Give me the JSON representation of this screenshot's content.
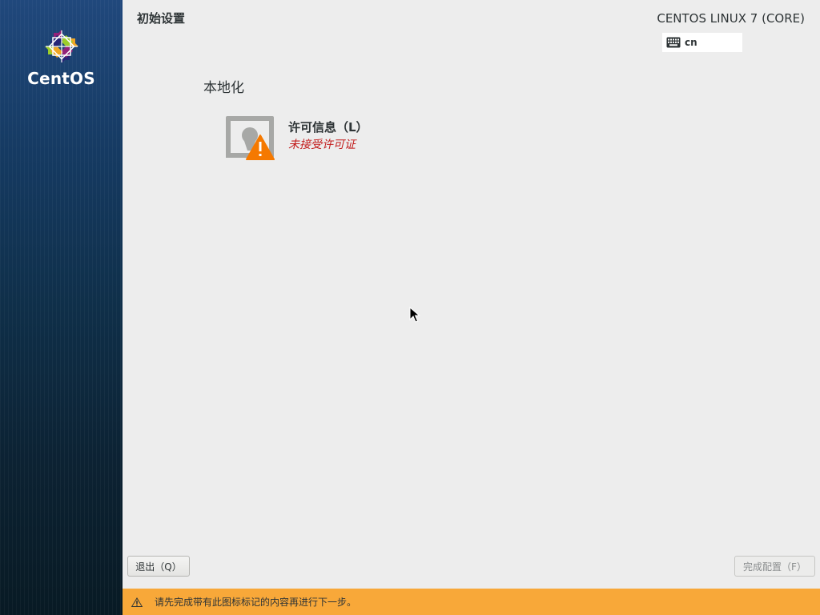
{
  "window": {
    "title": "初始设置",
    "product": "CENTOS LINUX 7 (CORE)"
  },
  "sidebar": {
    "logo_text": "CentOS",
    "logo_icon": "centos-logo"
  },
  "keyboard": {
    "icon": "keyboard-icon",
    "layout": "cn"
  },
  "categories": [
    {
      "title": "本地化",
      "spokes": [
        {
          "name": "许可信息（L）",
          "status": "未接受许可证",
          "icon": "license-warning-icon"
        }
      ]
    }
  ],
  "buttons": {
    "quit": "退出（Q）",
    "finish": "完成配置（F）"
  },
  "warning_bar": {
    "icon": "warning-icon",
    "text": "请先完成带有此图标标记的内容再进行下一步。"
  },
  "colors": {
    "warning": "#f8a839",
    "status_error": "#c21b1b",
    "sidebar_top": "#20487c",
    "sidebar_bottom": "#081a24"
  }
}
